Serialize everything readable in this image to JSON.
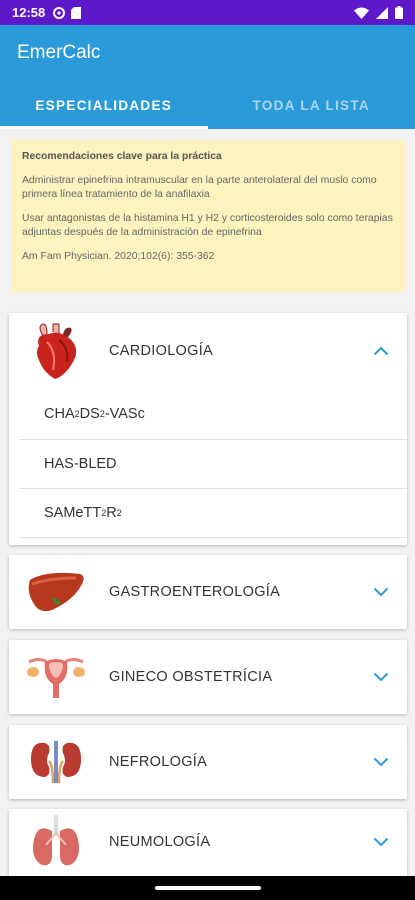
{
  "status": {
    "time": "12:58"
  },
  "app": {
    "title": "EmerCalc"
  },
  "tabs": [
    {
      "label": "ESPECIALIDADES",
      "active": true
    },
    {
      "label": "TODA LA LISTA",
      "active": false
    }
  ],
  "recommendation": {
    "title": "Recomendaciones clave para la práctica",
    "p1": "Administrar epinefrina intramuscular en la parte anterolateral del muslo como primera línea tratamiento de la anafilaxia",
    "p2": "Usar antagonistas de la histamina H1 y H2 y corticosteroides solo como terapias adjuntas después de la administración de epinefrina",
    "ref": "Am Fam Physician. 2020;102(6): 355-362"
  },
  "specialties": [
    {
      "label": "CARDIOLOGÍA",
      "icon": "heart-icon",
      "expanded": true,
      "items": [
        {
          "parts": [
            "CHA",
            "2",
            "DS",
            "2",
            "-VASc"
          ]
        },
        {
          "parts": [
            "HAS-BLED"
          ]
        },
        {
          "parts": [
            "SAMeTT",
            "2",
            "R",
            "2"
          ]
        }
      ]
    },
    {
      "label": "GASTROENTEROLOGÍA",
      "icon": "liver-icon",
      "expanded": false
    },
    {
      "label": "GINECO OBSTETRÍCIA",
      "icon": "uterus-icon",
      "expanded": false
    },
    {
      "label": "NEFROLOGÍA",
      "icon": "kidneys-icon",
      "expanded": false
    },
    {
      "label": "NEUMOLOGÍA",
      "icon": "lungs-icon",
      "expanded": false
    }
  ],
  "colors": {
    "status_bar": "#5c18c9",
    "primary": "#2b9ad8",
    "note_bg": "#fdf3be"
  }
}
